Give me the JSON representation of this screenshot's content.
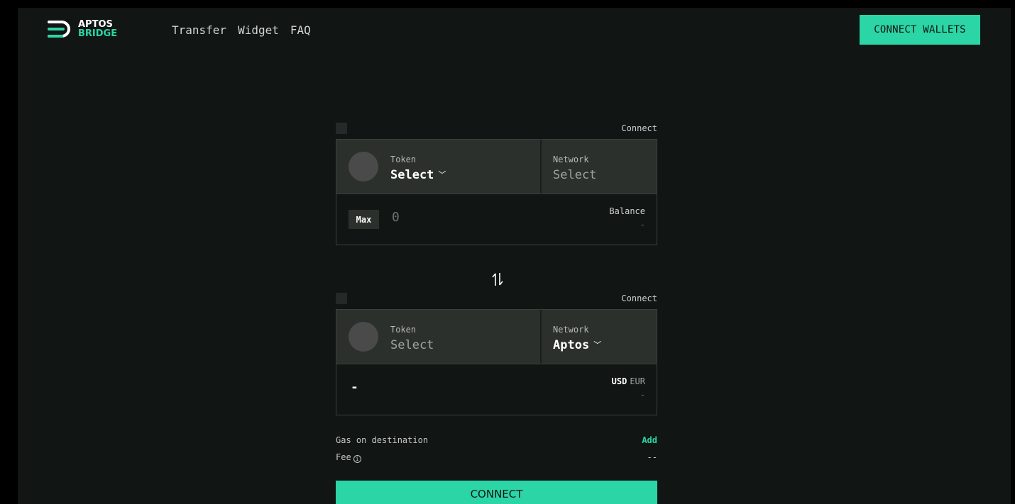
{
  "brand": {
    "line1": "APTOS",
    "line2": "BRIDGE",
    "accent": "#2cd5a5"
  },
  "nav": [
    {
      "label": "Transfer"
    },
    {
      "label": "Widget"
    },
    {
      "label": "FAQ"
    }
  ],
  "header": {
    "connect_wallets_label": "CONNECT WALLETS"
  },
  "source": {
    "connect_label": "Connect",
    "token_label": "Token",
    "token_value": "Select",
    "network_label": "Network",
    "network_value": "Select",
    "max_label": "Max",
    "amount_placeholder": "0",
    "balance_label": "Balance",
    "balance_value": "-"
  },
  "swap_icon": "swap-arrows-icon",
  "destination": {
    "connect_label": "Connect",
    "token_label": "Token",
    "token_value": "Select",
    "network_label": "Network",
    "network_value": "Aptos",
    "amount_value": "-",
    "currency_active": "USD",
    "currency_inactive": "EUR",
    "fiat_value": "-"
  },
  "gas": {
    "label": "Gas on destination",
    "action": "Add"
  },
  "fee": {
    "label": "Fee",
    "value": "--"
  },
  "connect_button_label": "CONNECT"
}
